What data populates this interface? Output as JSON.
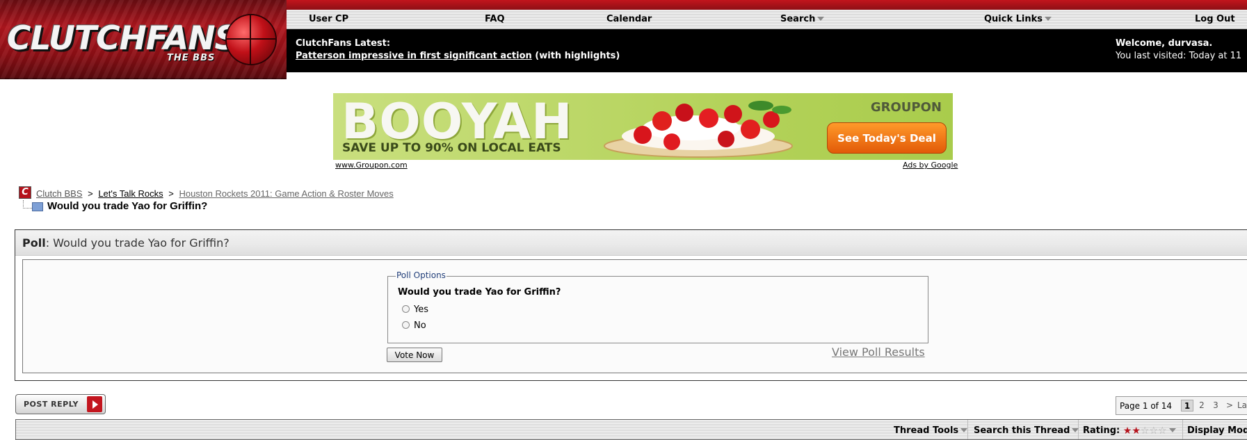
{
  "logo": {
    "text": "CLUTCHFANS",
    "subtext": "THE BBS"
  },
  "nav": {
    "items": [
      {
        "label": "User CP",
        "dropdown": false
      },
      {
        "label": "FAQ",
        "dropdown": false
      },
      {
        "label": "Calendar",
        "dropdown": false
      },
      {
        "label": "Search",
        "dropdown": true
      },
      {
        "label": "Quick Links",
        "dropdown": true
      },
      {
        "label": "Log Out",
        "dropdown": false
      }
    ]
  },
  "news": {
    "label": "ClutchFans Latest:",
    "link_text": "Patterson impressive in first significant action",
    "suffix": "(with highlights)"
  },
  "welcome": {
    "greeting": "Welcome, durvasa.",
    "last_visited": "You last visited: Today at 11"
  },
  "ad": {
    "headline": "BOOYAH",
    "subline": "SAVE UP TO 90% ON LOCAL EATS",
    "brand": "GROUPON",
    "cta": "See Today's Deal",
    "url": "www.Groupon.com",
    "ads_by": "Ads by Google"
  },
  "breadcrumb": {
    "icon_letter": "C",
    "root": "Clutch BBS",
    "sep": ">",
    "forum": "Let's Talk Rocks",
    "subforum": "Houston Rockets 2011: Game Action & Roster Moves",
    "thread_title": "Would you trade Yao for Griffin?"
  },
  "poll": {
    "label": "Poll",
    "title": ": Would you trade Yao for Griffin?",
    "legend": "Poll Options",
    "question": "Would you trade Yao for Griffin?",
    "options": [
      "Yes",
      "No"
    ],
    "vote_button": "Vote Now",
    "view_results": "View Poll Results"
  },
  "post_reply": {
    "label": "POST REPLY"
  },
  "pagination": {
    "label": "Page 1 of 14",
    "pages": [
      "1",
      "2",
      "3",
      ">",
      "Last"
    ],
    "current": "1"
  },
  "toolbar": {
    "thread_tools": "Thread Tools",
    "search_thread": "Search this Thread",
    "rating_label": "Rating:",
    "rating_stars": 2,
    "rating_max": 5,
    "display_modes": "Display Modes"
  },
  "colors": {
    "brand_red": "#b5121b",
    "news_bg": "#000000",
    "ad_bg": "#b5d35c",
    "cta_orange": "#e25a08"
  }
}
